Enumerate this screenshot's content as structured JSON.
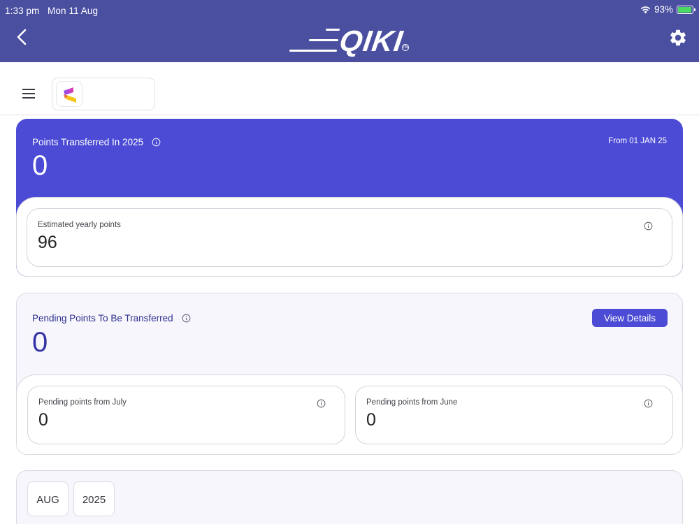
{
  "status_bar": {
    "time": "1:33 pm",
    "date": "Mon 11 Aug",
    "battery": "93%",
    "battery_level": 0.93
  },
  "header": {
    "logo_text": "QIKI",
    "back_icon": "chevron-left-icon",
    "settings_icon": "gear-icon"
  },
  "subheader": {
    "menu_icon": "hamburger-menu-icon"
  },
  "transferred_card": {
    "title": "Points Transferred In 2025",
    "value": "0",
    "from_label": "From 01 JAN 25",
    "estimated": {
      "label": "Estimated yearly points",
      "value": "96"
    }
  },
  "pending_card": {
    "title": "Pending Points To Be Transferred",
    "value": "0",
    "view_details_label": "View Details",
    "july": {
      "label": "Pending points from July",
      "value": "0"
    },
    "june": {
      "label": "Pending points from June",
      "value": "0"
    }
  },
  "filter": {
    "month": "AUG",
    "year": "2025"
  },
  "colors": {
    "header_bg": "#4a4fa0",
    "accent": "#4b4bd5",
    "pending_title": "#2e2e8e"
  }
}
